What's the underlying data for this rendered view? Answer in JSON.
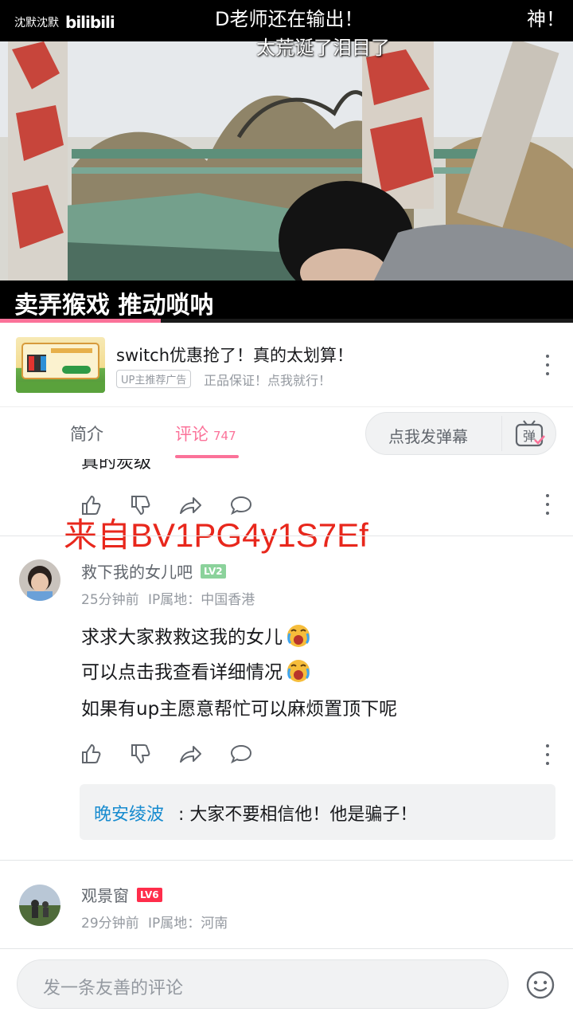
{
  "video": {
    "uploader_watermark": "沈默沈默",
    "logo": "bilibili",
    "danmaku": [
      "D老师还在输出！",
      "太荒诞了泪目了",
      "神！"
    ],
    "subtitle": "卖弄猴戏 推动唢呐",
    "progress_fraction": 0.28
  },
  "ad": {
    "title": "switch优惠抢了！真的太划算！",
    "tag": "UP主推荐广告",
    "subtitle": "正品保证！点我就行！",
    "more_icon": "more-vertical-icon"
  },
  "tabs": {
    "intro": "简介",
    "comments": "评论",
    "comment_count": "747",
    "danmaku_placeholder": "点我发弹幕",
    "danmaku_icon": "弹"
  },
  "watermark_text": "来自BV1PG4y1S7Ef",
  "comments": [
    {
      "cut_text": "真的炭级",
      "icons": [
        "like-icon",
        "dislike-icon",
        "share-icon",
        "reply-icon",
        "more-vertical-icon"
      ]
    },
    {
      "username": "救下我的女儿吧",
      "level": "LV2",
      "time": "25分钟前",
      "ip": "IP属地：中国香港",
      "lines": [
        "求求大家救救这我的女儿",
        "可以点击我查看详细情况",
        "如果有up主愿意帮忙可以麻烦置顶下呢"
      ],
      "emoji": "crying-face-emoji",
      "reply": {
        "name": "晚安绫波",
        "text": ": 大家不要相信他！他是骗子！"
      }
    },
    {
      "username": "观景窗",
      "level": "LV6",
      "time": "29分钟前",
      "ip": "IP属地：河南"
    }
  ],
  "bottom": {
    "placeholder": "发一条友善的评论",
    "emoji_icon": "smiley-icon"
  },
  "colors": {
    "accent": "#fb7299",
    "reply_name": "#178bcf",
    "watermark": "#e8271c",
    "lv2": "#8bd29b",
    "lv6": "#ff2d4b"
  }
}
